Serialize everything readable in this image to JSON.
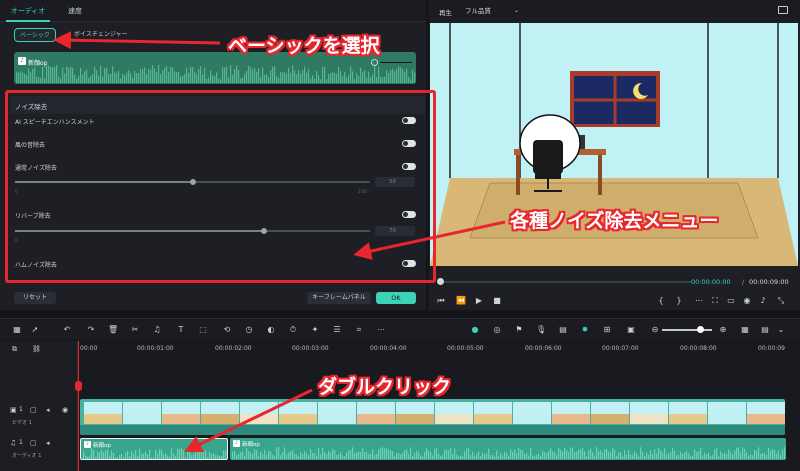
{
  "left_panel": {
    "tabs": [
      "オーディオ",
      "速度"
    ],
    "sub_tabs": [
      "ベーシック",
      "ボイスチェンジャー"
    ],
    "clip_name": "新顔op",
    "noise": {
      "title": "ノイズ除去",
      "ai_speech": "AI スピーチエンハンスメント",
      "wind": "風の音除去",
      "normal": "通常ノイズ除去",
      "normal_value": "50",
      "normal_fraction": 0.5,
      "normal_min": "0",
      "normal_max": "100",
      "reverb": "リバーブ除去",
      "reverb_value": "70",
      "reverb_fraction": 0.7,
      "reverb_min": "0",
      "hum": "ハムノイズ除去"
    },
    "buttons": {
      "reset": "リセット",
      "keyframe": "キーフレームパネル",
      "ok": "OK"
    }
  },
  "preview": {
    "label": "再生",
    "quality": "フル品質",
    "time_current": "00:00:00:00",
    "time_sep": "/",
    "time_total": "00:00:09:00"
  },
  "timeline": {
    "ruler": [
      "00:00",
      "00:00:01:00",
      "00:00:02:00",
      "00:00:03:00",
      "00:00:04:00",
      "00:00:05:00",
      "00:00:06:00",
      "00:00:07:00",
      "00:00:08:00",
      "00:00:09"
    ],
    "video_track_label": "ビデオ 1",
    "audio_track_label": "オーディオ 1",
    "video_track_num": "1",
    "audio_track_num": "1",
    "audio_clips": [
      "新顔op",
      "新顔op"
    ]
  },
  "annotations": {
    "basic": "ベーシックを選択",
    "noise_menu": "各種ノイズ除去メニュー",
    "double_click": "ダブルクリック"
  },
  "colors": {
    "accent": "#3ed2b6",
    "annotation_red": "#e8262e",
    "audio_clip": "#3aa58d",
    "video_clip": "#4ab0a2"
  }
}
